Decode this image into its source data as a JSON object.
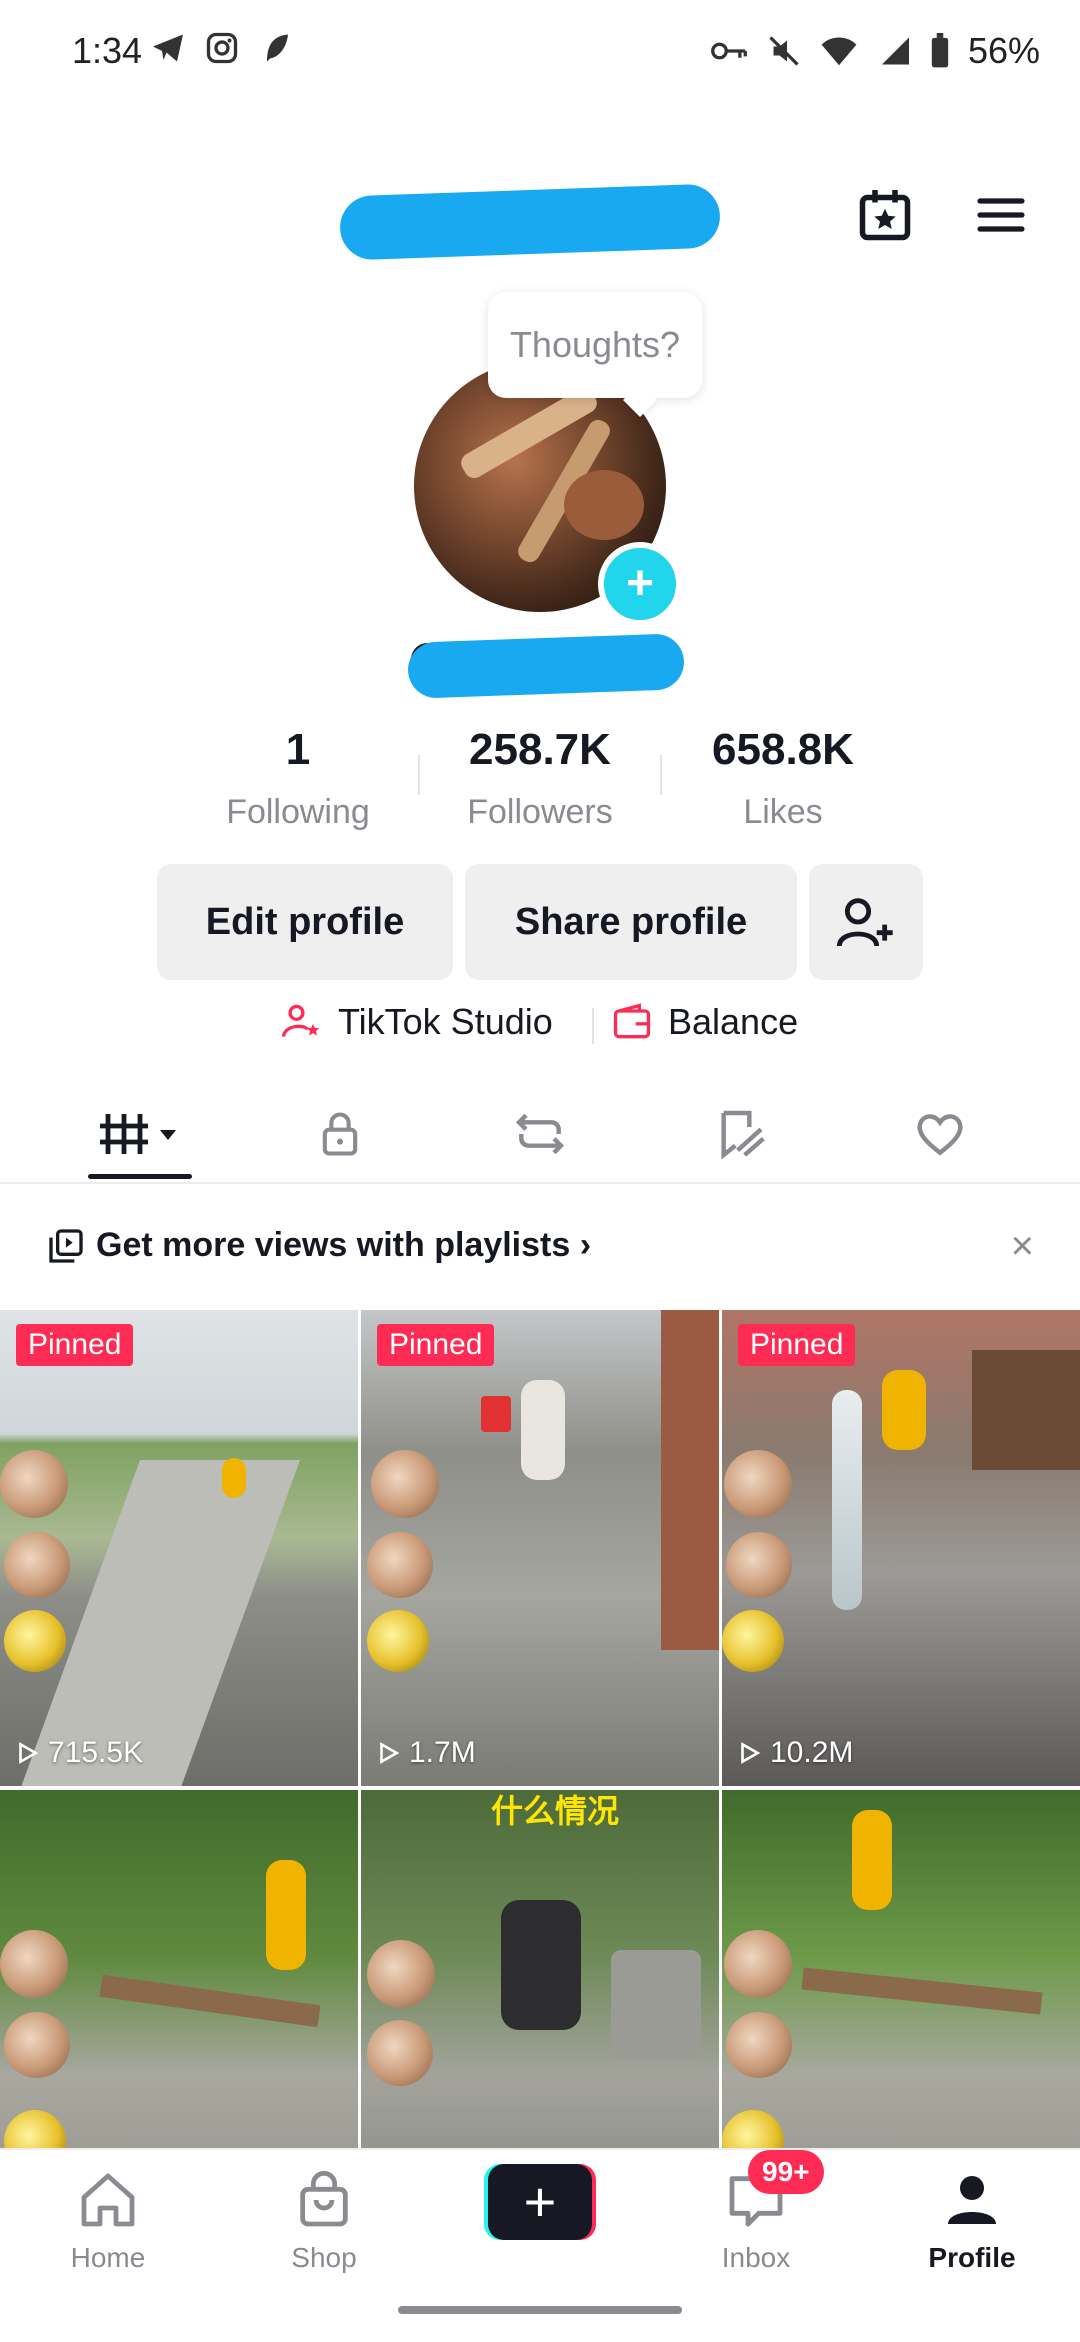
{
  "status_bar": {
    "time": "1:34",
    "battery": "56%",
    "left_icons": [
      "telegram-icon",
      "instagram-icon",
      "feather-icon"
    ],
    "right_icons": [
      "key-icon",
      "mute-icon",
      "wifi-icon",
      "signal-icon",
      "battery-icon"
    ]
  },
  "header": {
    "username": "",
    "icons": [
      "calendar-star-icon",
      "menu-icon"
    ]
  },
  "profile": {
    "bubble": "Thoughts?",
    "handle": "@r"
  },
  "stats": [
    {
      "value": "1",
      "label": "Following"
    },
    {
      "value": "258.7K",
      "label": "Followers"
    },
    {
      "value": "658.8K",
      "label": "Likes"
    }
  ],
  "buttons": {
    "edit": "Edit profile",
    "share": "Share profile"
  },
  "links": {
    "studio": "TikTok Studio",
    "balance": "Balance"
  },
  "tabs": [
    "videos-grid-icon",
    "lock-icon",
    "repost-icon",
    "saved-icon",
    "heart-icon"
  ],
  "banner": {
    "text": "Get more views with playlists",
    "chevron": "›",
    "close": "×"
  },
  "grid": [
    {
      "pinned": "Pinned",
      "views": "715.5K"
    },
    {
      "pinned": "Pinned",
      "views": "1.7M"
    },
    {
      "pinned": "Pinned",
      "views": "10.2M"
    },
    {
      "pinned": "",
      "views": ""
    },
    {
      "pinned": "",
      "views": "",
      "caption": "什么情况"
    },
    {
      "pinned": "",
      "views": ""
    }
  ],
  "nav": {
    "home": "Home",
    "shop": "Shop",
    "inbox": "Inbox",
    "profile": "Profile",
    "inbox_badge": "99+"
  },
  "colors": {
    "accent": "#fe2c55",
    "teal": "#20d5ec",
    "mask_blue": "#18a9f0"
  }
}
